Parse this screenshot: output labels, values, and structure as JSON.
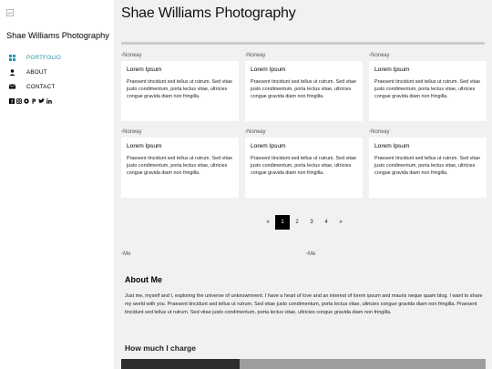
{
  "sidebar": {
    "logo_alt": "",
    "brand": "Shae Williams Photography",
    "nav": [
      {
        "label": "PORTFOLIO",
        "icon": "grid-icon",
        "active": true
      },
      {
        "label": "ABOUT",
        "icon": "user-icon",
        "active": false
      },
      {
        "label": "CONTACT",
        "icon": "envelope-icon",
        "active": false
      }
    ],
    "social": [
      "facebook-icon",
      "instagram-icon",
      "snapchat-icon",
      "pinterest-icon",
      "twitter-icon",
      "linkedin-icon"
    ]
  },
  "main": {
    "title": "Shae Williams Photography",
    "cards": [
      {
        "img_alt": "Norway",
        "title": "Lorem Ipsum",
        "text": "Praesent tincidunt sed tellus ut rutrum. Sed vitae justo condimentum, porta lectus vitae, ultricies congue gravida diam non fringilla."
      },
      {
        "img_alt": "Norway",
        "title": "Lorem Ipsum",
        "text": "Praesent tincidunt sed tellus ut rutrum. Sed vitae justo condimentum, porta lectus vitae, ultricies congue gravida diam non fringilla."
      },
      {
        "img_alt": "Norway",
        "title": "Lorem Ipsum",
        "text": "Praesent tincidunt sed tellus ut rutrum. Sed vitae justo condimentum, porta lectus vitae, ultricies congue gravida diam non fringilla."
      },
      {
        "img_alt": "Norway",
        "title": "Lorem Ipsum",
        "text": "Praesent tincidunt sed tellus ut rutrum. Sed vitae justo condimentum, porta lectus vitae, ultricies congue gravida diam non fringilla."
      },
      {
        "img_alt": "Norway",
        "title": "Lorem Ipsum",
        "text": "Praesent tincidunt sed tellus ut rutrum. Sed vitae justo condimentum, porta lectus vitae, ultricies congue gravida diam non fringilla."
      },
      {
        "img_alt": "Norway",
        "title": "Lorem Ipsum",
        "text": "Praesent tincidunt sed tellus ut rutrum. Sed vitae justo condimentum, porta lectus vitae, ultricies congue gravida diam non fringilla."
      }
    ],
    "pagination": {
      "prev": "«",
      "pages": [
        "1",
        "2",
        "3",
        "4"
      ],
      "active": "1",
      "next": "»"
    },
    "me_img_alts": [
      "Me",
      "Me"
    ],
    "about": {
      "heading": "About Me",
      "text": "Just me, myself and I, exploring the universe of unknownment. I have a heart of love and an interest of lorem ipsum and mauris neque quam blog. I want to share my world with you. Praesent tincidunt sed tellus ut rutrum. Sed vitae justo condimentum, porta lectus vitae, ultricies congue gravida diam non fringilla. Praesent tincidunt sed tellus ut rutrum. Sed vitae justo condimentum, porta lectus vitae, ultricies congue gravida diam non fringilla."
    },
    "charge": {
      "heading": "How much I charge",
      "progress": 0.325
    }
  },
  "colors": {
    "accent": "#2196a8",
    "background": "#f1f1f1",
    "progress_fill": "#2e2e2e",
    "progress_track": "#9e9e9e"
  }
}
